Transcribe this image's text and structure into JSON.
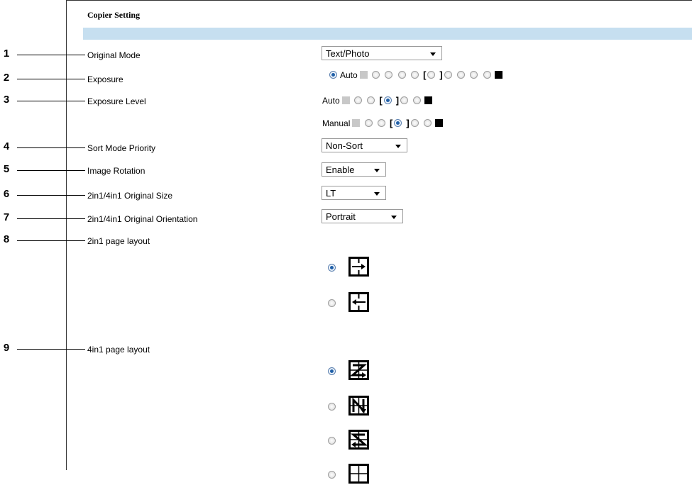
{
  "section": {
    "title": "Copier Setting"
  },
  "callouts": [
    "1",
    "2",
    "3",
    "4",
    "5",
    "6",
    "7",
    "8",
    "9"
  ],
  "rows": {
    "original_mode": {
      "label": "Original Mode",
      "value": "Text/Photo"
    },
    "exposure": {
      "label": "Exposure",
      "auto_label": "Auto"
    },
    "exposure_level": {
      "label": "Exposure Level",
      "auto_label": "Auto",
      "manual_label": "Manual"
    },
    "sort_mode_priority": {
      "label": "Sort Mode Priority",
      "value": "Non-Sort"
    },
    "image_rotation": {
      "label": "Image Rotation",
      "value": "Enable"
    },
    "original_size": {
      "label": "2in1/4in1 Original Size",
      "value": "LT"
    },
    "original_orientation": {
      "label": "2in1/4in1 Original Orientation",
      "value": "Portrait"
    },
    "layout_2in1": {
      "label": "2in1 page layout",
      "options": [
        "left-to-right",
        "right-to-left"
      ],
      "selected": 0
    },
    "layout_4in1": {
      "label": "4in1 page layout",
      "options": [
        "z-horizontal",
        "n-vertical",
        "reverse-z-horizontal",
        "reverse-n-vertical"
      ],
      "selected": 0
    }
  },
  "colors": {
    "header_bar": "#c6dff0",
    "radio_selected": "#1f5fa8"
  }
}
